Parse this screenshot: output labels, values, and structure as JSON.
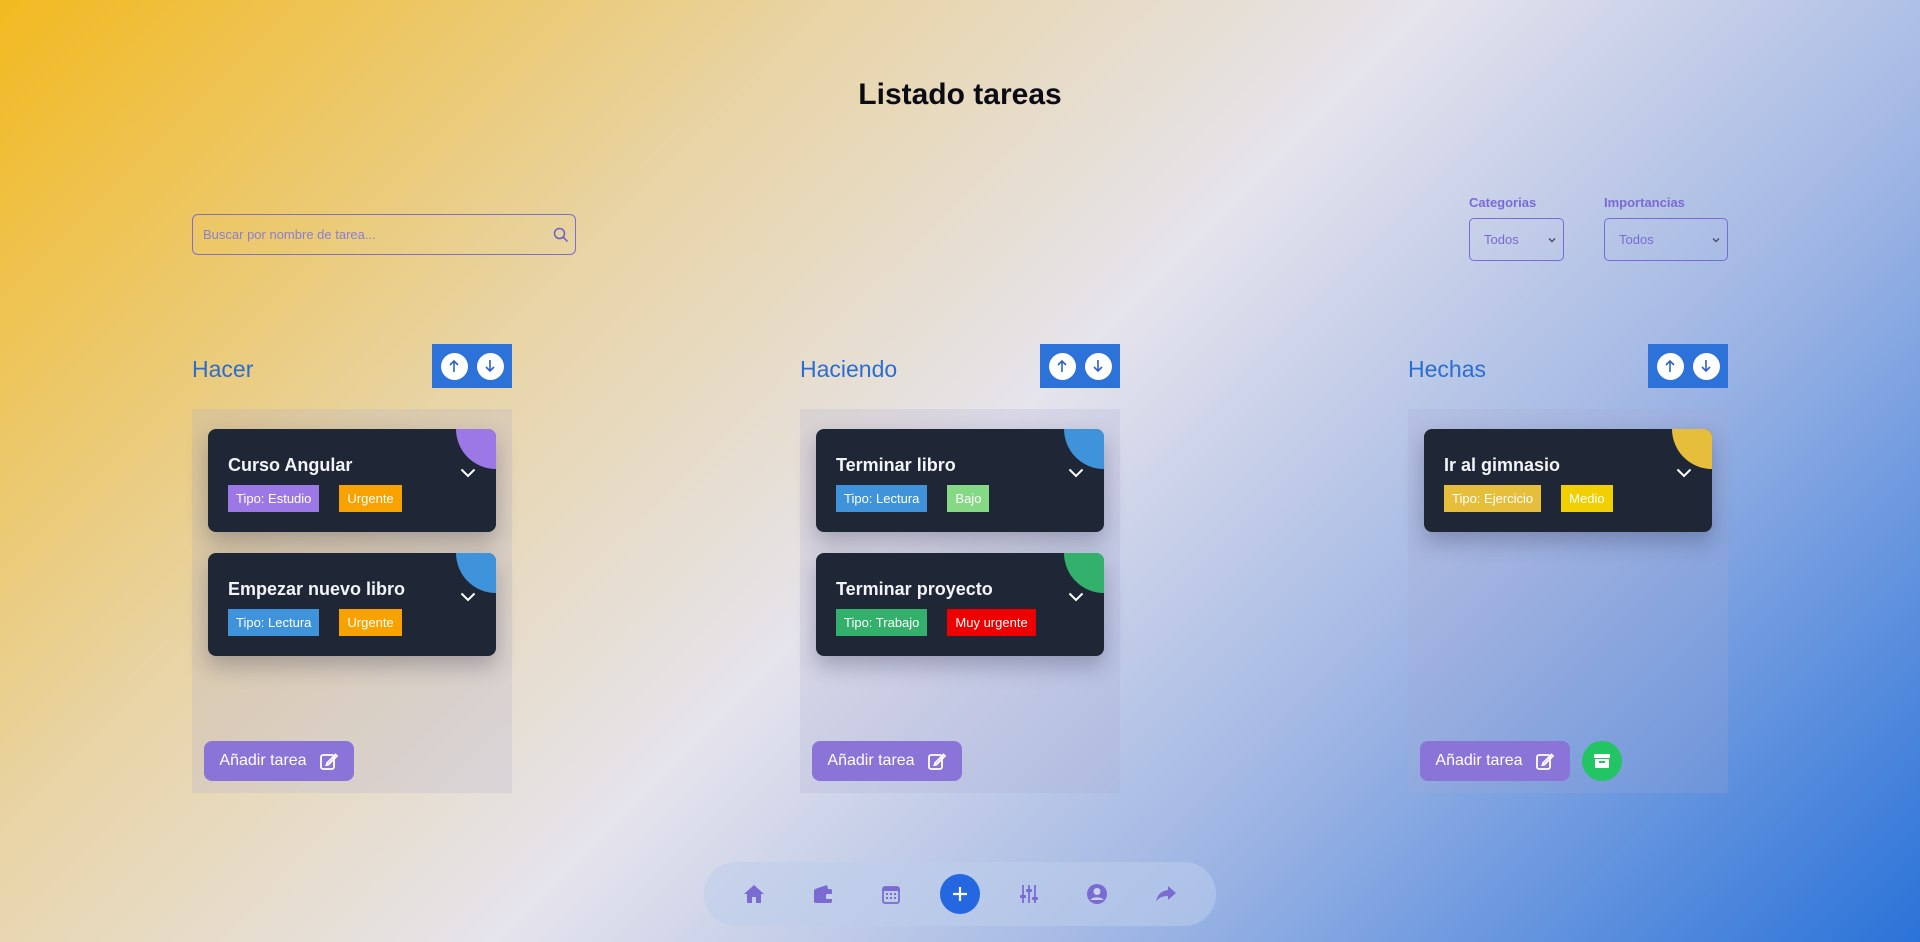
{
  "page": {
    "title": "Listado tareas"
  },
  "search": {
    "placeholder": "Buscar por nombre de tarea..."
  },
  "filters": {
    "categories": {
      "label": "Categorias",
      "value": "Todos"
    },
    "importance": {
      "label": "Importancias",
      "value": "Todos"
    }
  },
  "columns": [
    {
      "title": "Hacer",
      "add_label": "Añadir tarea",
      "cards": [
        {
          "name": "Curso Angular",
          "type": "Tipo: Estudio",
          "type_color": "#9b78e6",
          "priority": "Urgente",
          "priority_color": "#f8a200",
          "corner_color": "#9b78e6"
        },
        {
          "name": "Empezar nuevo libro",
          "type": "Tipo: Lectura",
          "type_color": "#3f93db",
          "priority": "Urgente",
          "priority_color": "#f8a200",
          "corner_color": "#3f93db"
        }
      ]
    },
    {
      "title": "Haciendo",
      "add_label": "Añadir tarea",
      "cards": [
        {
          "name": "Terminar libro",
          "type": "Tipo: Lectura",
          "type_color": "#3f93db",
          "priority": "Bajo",
          "priority_color": "#86d984",
          "corner_color": "#3f93db"
        },
        {
          "name": "Terminar proyecto",
          "type": "Tipo: Trabajo",
          "type_color": "#33b16c",
          "priority": "Muy urgente",
          "priority_color": "#ee0000",
          "corner_color": "#33b16c"
        }
      ]
    },
    {
      "title": "Hechas",
      "add_label": "Añadir tarea",
      "cards": [
        {
          "name": "Ir al gimnasio",
          "type": "Tipo: Ejercicio",
          "type_color": "#e6be3c",
          "priority": "Medio",
          "priority_color": "#f2cf00",
          "corner_color": "#e6be3c"
        }
      ]
    }
  ],
  "nav": {
    "items": [
      "home-icon",
      "wallet-icon",
      "calendar-icon",
      "plus-icon",
      "sliders-icon",
      "user-icon",
      "share-icon"
    ],
    "accent": "#2567e0",
    "icon_color": "#7a6bd3"
  }
}
